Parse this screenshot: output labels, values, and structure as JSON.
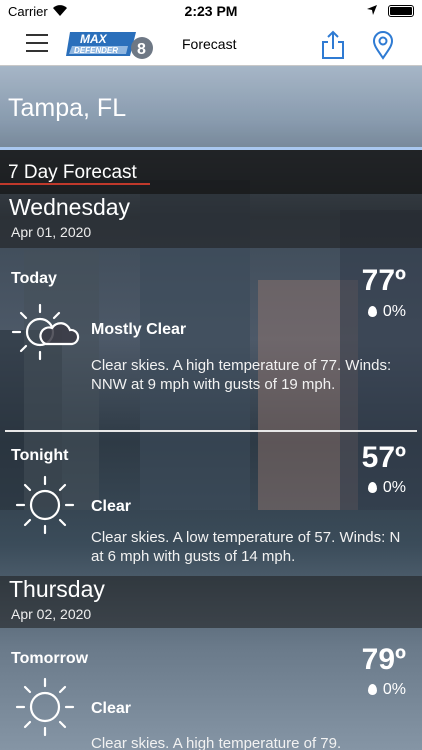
{
  "status_bar": {
    "carrier": "Carrier",
    "time": "2:23 PM"
  },
  "nav": {
    "title": "Forecast",
    "logo_text_top": "MAX",
    "logo_text_bottom": "DEFENDER",
    "logo_number": "8"
  },
  "location": {
    "city": "Tampa, FL"
  },
  "forecast_header": "7 Day Forecast",
  "days": [
    {
      "name": "Wednesday",
      "date": "Apr 01, 2020",
      "periods": [
        {
          "name": "Today",
          "temp": "77º",
          "precip": "0%",
          "icon": "partly-cloudy-icon",
          "condition": "Mostly Clear",
          "description": "Clear skies.  A high temperature of 77. Winds: NNW at 9 mph with gusts of 19 mph."
        },
        {
          "name": "Tonight",
          "temp": "57º",
          "precip": "0%",
          "icon": "sun-icon",
          "condition": "Clear",
          "description": "Clear skies.  A low temperature of 57. Winds: N at 6 mph with gusts of 14 mph."
        }
      ]
    },
    {
      "name": "Thursday",
      "date": "Apr 02, 2020",
      "periods": [
        {
          "name": "Tomorrow",
          "temp": "79º",
          "precip": "0%",
          "icon": "sun-icon",
          "condition": "Clear",
          "description": "Clear skies.  A high temperature of 79."
        }
      ]
    }
  ]
}
